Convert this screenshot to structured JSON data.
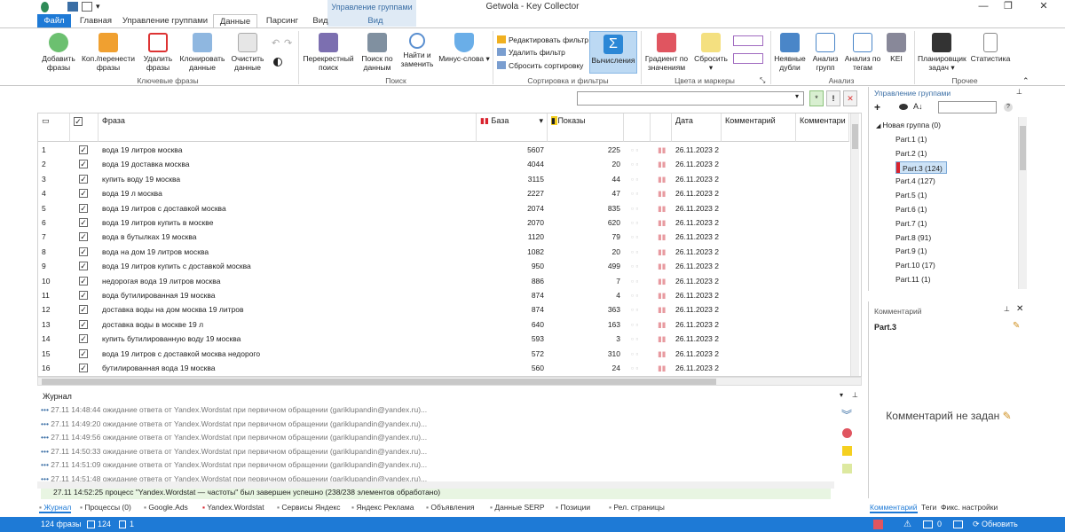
{
  "window": {
    "title": "Getwola - Key Collector"
  },
  "context_tab": {
    "group": "Управление группами",
    "label": "Вид"
  },
  "tabs": [
    "Файл",
    "Главная",
    "Управление группами",
    "Данные",
    "Парсинг",
    "Вид"
  ],
  "ribbon": {
    "key_phrases": {
      "label": "Ключевые фразы",
      "add": "Добавить фразы",
      "copy_move": "Коп./перенести фразы",
      "delete": "Удалить фразы",
      "clone": "Клонировать данные",
      "clear": "Очистить данные"
    },
    "search": {
      "label": "Поиск",
      "cross": "Перекрестный поиск",
      "by_data": "Поиск по данным",
      "find_replace": "Найти и заменить",
      "minus": "Минус-слова"
    },
    "sort_filter": {
      "label": "Сортировка и фильтры",
      "edit_filter": "Редактировать фильтр",
      "delete_filter": "Удалить фильтр",
      "reset_sort": "Сбросить сортировку",
      "calc": "Вычисления"
    },
    "colors": {
      "label": "Цвета и маркеры",
      "gradient": "Градиент по значениям",
      "reset": "Сбросить"
    },
    "analysis": {
      "label": "Анализ",
      "implicit": "Неявные дубли",
      "groups": "Анализ групп",
      "by_tags": "Анализ по тегам",
      "kei": "KEI"
    },
    "other": {
      "label": "Прочее",
      "scheduler": "Планировщик задач",
      "stats": "Статистика"
    }
  },
  "grid": {
    "headers": {
      "phrase": "Фраза",
      "base": "База",
      "shows": "Показы",
      "date": "Дата",
      "comment": "Комментарий",
      "comment2": "Комментари"
    },
    "rows": [
      {
        "n": "1",
        "phrase": "вода 19 литров москва",
        "base": "5607",
        "shows": "225",
        "date": "26.11.2023 2"
      },
      {
        "n": "2",
        "phrase": "вода 19 доставка москва",
        "base": "4044",
        "shows": "20",
        "date": "26.11.2023 2"
      },
      {
        "n": "3",
        "phrase": "купить воду 19 москва",
        "base": "3115",
        "shows": "44",
        "date": "26.11.2023 2"
      },
      {
        "n": "4",
        "phrase": "вода 19 л москва",
        "base": "2227",
        "shows": "47",
        "date": "26.11.2023 2"
      },
      {
        "n": "5",
        "phrase": "вода 19 литров с доставкой москва",
        "base": "2074",
        "shows": "835",
        "date": "26.11.2023 2"
      },
      {
        "n": "6",
        "phrase": "вода 19 литров купить в москве",
        "base": "2070",
        "shows": "620",
        "date": "26.11.2023 2"
      },
      {
        "n": "7",
        "phrase": "вода в бутылках 19 москва",
        "base": "1120",
        "shows": "79",
        "date": "26.11.2023 2"
      },
      {
        "n": "8",
        "phrase": "вода на дом 19 литров москва",
        "base": "1082",
        "shows": "20",
        "date": "26.11.2023 2"
      },
      {
        "n": "9",
        "phrase": "вода 19 литров купить с доставкой москва",
        "base": "950",
        "shows": "499",
        "date": "26.11.2023 2"
      },
      {
        "n": "10",
        "phrase": "недорогая вода 19 литров москва",
        "base": "886",
        "shows": "7",
        "date": "26.11.2023 2"
      },
      {
        "n": "11",
        "phrase": "вода бутилированная 19 москва",
        "base": "874",
        "shows": "4",
        "date": "26.11.2023 2"
      },
      {
        "n": "12",
        "phrase": "доставка воды на дом москва 19 литров",
        "base": "874",
        "shows": "363",
        "date": "26.11.2023 2"
      },
      {
        "n": "13",
        "phrase": "доставка воды в москве 19 л",
        "base": "640",
        "shows": "163",
        "date": "26.11.2023 2"
      },
      {
        "n": "14",
        "phrase": "купить бутилированную воду 19 москва",
        "base": "593",
        "shows": "3",
        "date": "26.11.2023 2"
      },
      {
        "n": "15",
        "phrase": "вода 19 литров с доставкой москва недорого",
        "base": "572",
        "shows": "310",
        "date": "26.11.2023 2"
      },
      {
        "n": "16",
        "phrase": "бутилированная вода 19 москва",
        "base": "560",
        "shows": "24",
        "date": "26.11.2023 2"
      }
    ]
  },
  "journal": {
    "title": "Журнал",
    "entries": [
      {
        "time": "27.11 14:48:44",
        "text": "ожидание ответа от Yandex.Wordstat при первичном обращении (gariklupandin@yandex.ru)..."
      },
      {
        "time": "27.11 14:49:20",
        "text": "ожидание ответа от Yandex.Wordstat при первичном обращении (gariklupandin@yandex.ru)..."
      },
      {
        "time": "27.11 14:49:56",
        "text": "ожидание ответа от Yandex.Wordstat при первичном обращении (gariklupandin@yandex.ru)..."
      },
      {
        "time": "27.11 14:50:33",
        "text": "ожидание ответа от Yandex.Wordstat при первичном обращении (gariklupandin@yandex.ru)..."
      },
      {
        "time": "27.11 14:51:09",
        "text": "ожидание ответа от Yandex.Wordstat при первичном обращении (gariklupandin@yandex.ru)..."
      },
      {
        "time": "27.11 14:51:48",
        "text": "ожидание ответа от Yandex.Wordstat при первичном обращении (gariklupandin@yandex.ru)..."
      }
    ],
    "done": {
      "time": "27.11 14:52:25",
      "text": "процесс \"Yandex.Wordstat — частоты\" был завершен успешно (238/238 элементов обработано)"
    }
  },
  "bottom_tabs": [
    "Журнал",
    "Процессы (0)",
    "Google.Ads",
    "Yandex.Wordstat",
    "Сервисы Яндекс",
    "Яндекс Реклама",
    "Объявления",
    "Данные SERP",
    "Позиции",
    "Рел. страницы"
  ],
  "groups_panel": {
    "title": "Управление группами",
    "root": "Новая группа (0)",
    "items": [
      "Part.1 (1)",
      "Part.2 (1)",
      "Part.3 (124)",
      "Part.4 (127)",
      "Part.5 (1)",
      "Part.6 (1)",
      "Part.7 (1)",
      "Part.8 (91)",
      "Part.9 (1)",
      "Part.10 (17)",
      "Part.11 (1)"
    ]
  },
  "comment_panel": {
    "title": "Комментарий",
    "group": "Part.3",
    "empty": "Комментарий не задан"
  },
  "right_tabs": [
    "Комментарий",
    "Теги",
    "Фикс. настройки"
  ],
  "status": {
    "phrases": "124 фразы",
    "checked": "124",
    "selected": "1",
    "zero": "0",
    "refresh": "Обновить"
  },
  "colors": {
    "accent": "#1e7ad6",
    "active_group": "#cde3f7",
    "marker": "#d9232e",
    "ok_row": "#e8f5e2"
  }
}
